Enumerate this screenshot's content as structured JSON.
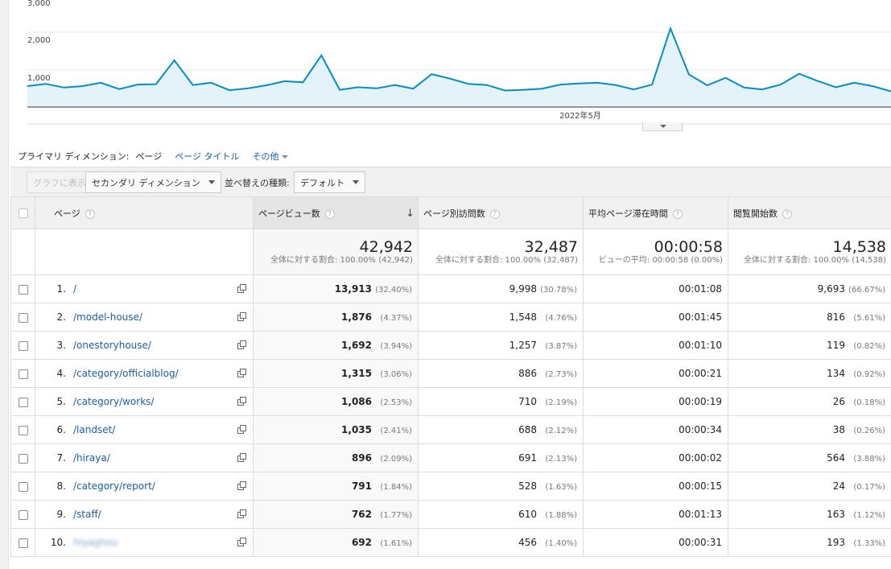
{
  "chart": {
    "type": "line",
    "y_ticks": [
      "3,000",
      "2,000",
      "1,000"
    ],
    "y_tick_values": [
      3000,
      2000,
      1000
    ],
    "x_label": "2022年5月",
    "series_color": "#058dc7",
    "values": [
      560,
      620,
      520,
      560,
      650,
      480,
      600,
      610,
      1250,
      590,
      650,
      450,
      500,
      580,
      690,
      660,
      1380,
      460,
      530,
      500,
      590,
      490,
      880,
      760,
      620,
      590,
      440,
      460,
      490,
      600,
      630,
      650,
      590,
      470,
      600,
      2100,
      870,
      580,
      780,
      520,
      470,
      600,
      890,
      700,
      530,
      650,
      560,
      420
    ]
  },
  "dimension": {
    "label": "プライマリ ディメンション:",
    "current": "ページ",
    "alt": "ページ タイトル",
    "more": "その他"
  },
  "controls": {
    "graph_button": "グラフに表示",
    "secondary_dimension": "セカンダリ ディメンション",
    "sort_label": "並べ替えの種類:",
    "sort_value": "デフォルト"
  },
  "columns": {
    "page": "ページ",
    "pageviews": "ページビュー数",
    "unique_pageviews": "ページ別訪問数",
    "avg_time": "平均ページ滞在時間",
    "entrances": "閲覧開始数"
  },
  "totals": {
    "pageviews": "42,942",
    "pageviews_sub": "全体に対する割合: 100.00% (42,942)",
    "unique_pageviews": "32,487",
    "unique_pageviews_sub": "全体に対する割合: 100.00% (32,487)",
    "avg_time": "00:00:58",
    "avg_time_sub": "ビューの平均: 00:00:58 (0.00%)",
    "entrances": "14,538",
    "entrances_sub": "全体に対する割合: 100.00% (14,538)"
  },
  "rows": [
    {
      "num": "1.",
      "page": "/",
      "pv": "13,913",
      "pv_pct": "(32.40%)",
      "upv": "9,998",
      "upv_pct": "(30.78%)",
      "time": "00:01:08",
      "ent": "9,693",
      "ent_pct": "(66.67%)"
    },
    {
      "num": "2.",
      "page": "/model-house/",
      "pv": "1,876",
      "pv_pct": "(4.37%)",
      "upv": "1,548",
      "upv_pct": "(4.76%)",
      "time": "00:01:45",
      "ent": "816",
      "ent_pct": "(5.61%)"
    },
    {
      "num": "3.",
      "page": "/onestoryhouse/",
      "pv": "1,692",
      "pv_pct": "(3.94%)",
      "upv": "1,257",
      "upv_pct": "(3.87%)",
      "time": "00:01:10",
      "ent": "119",
      "ent_pct": "(0.82%)"
    },
    {
      "num": "4.",
      "page": "/category/officialblog/",
      "pv": "1,315",
      "pv_pct": "(3.06%)",
      "upv": "886",
      "upv_pct": "(2.73%)",
      "time": "00:00:21",
      "ent": "134",
      "ent_pct": "(0.92%)"
    },
    {
      "num": "5.",
      "page": "/category/works/",
      "pv": "1,086",
      "pv_pct": "(2.53%)",
      "upv": "710",
      "upv_pct": "(2.19%)",
      "time": "00:00:19",
      "ent": "26",
      "ent_pct": "(0.18%)"
    },
    {
      "num": "6.",
      "page": "/landset/",
      "pv": "1,035",
      "pv_pct": "(2.41%)",
      "upv": "688",
      "upv_pct": "(2.12%)",
      "time": "00:00:34",
      "ent": "38",
      "ent_pct": "(0.26%)"
    },
    {
      "num": "7.",
      "page": "/hiraya/",
      "pv": "896",
      "pv_pct": "(2.09%)",
      "upv": "691",
      "upv_pct": "(2.13%)",
      "time": "00:00:02",
      "ent": "564",
      "ent_pct": "(3.88%)"
    },
    {
      "num": "8.",
      "page": "/category/report/",
      "pv": "791",
      "pv_pct": "(1.84%)",
      "upv": "528",
      "upv_pct": "(1.63%)",
      "time": "00:00:15",
      "ent": "24",
      "ent_pct": "(0.17%)"
    },
    {
      "num": "9.",
      "page": "/staff/",
      "pv": "762",
      "pv_pct": "(1.77%)",
      "upv": "610",
      "upv_pct": "(1.88%)",
      "time": "00:01:13",
      "ent": "163",
      "ent_pct": "(1.12%)"
    },
    {
      "num": "10.",
      "page": "",
      "pv": "692",
      "pv_pct": "(1.61%)",
      "upv": "456",
      "upv_pct": "(1.40%)",
      "time": "00:00:31",
      "ent": "193",
      "ent_pct": "(1.33%)"
    }
  ]
}
